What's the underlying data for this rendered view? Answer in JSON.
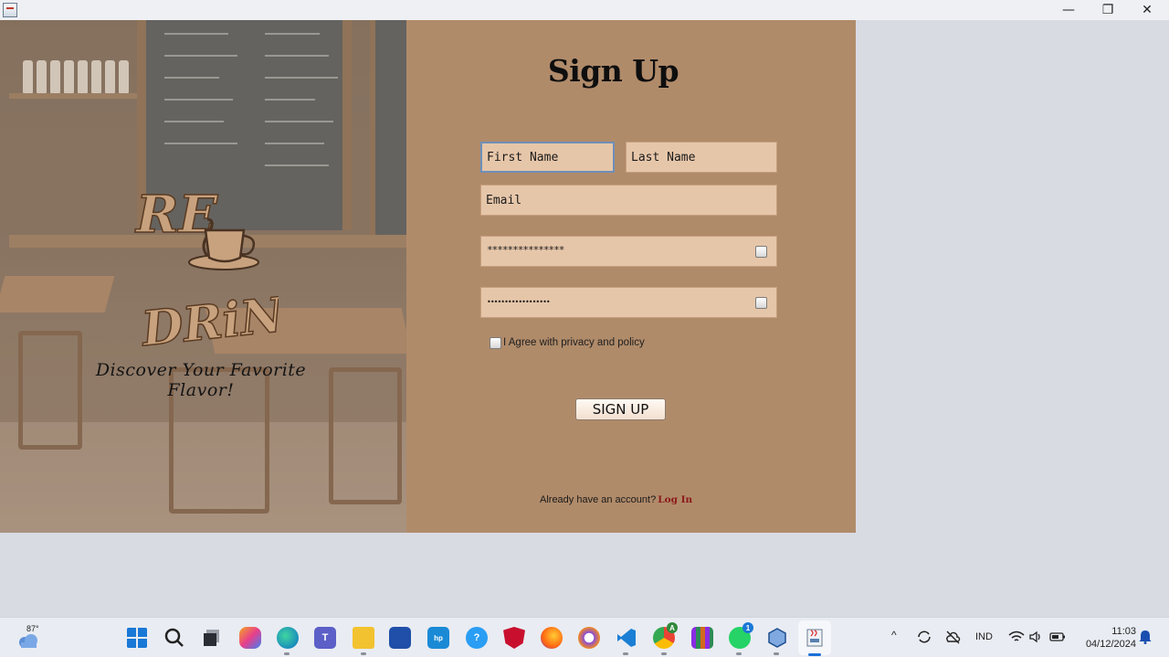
{
  "window": {
    "controls": {
      "minimize": "—",
      "maximize": "❐",
      "close": "✕"
    }
  },
  "hero": {
    "logo_text_top": "RE",
    "logo_text_bottom": "DRiNK",
    "tagline": "Discover Your Favorite Flavor!"
  },
  "form": {
    "title": "Sign Up",
    "first_name_placeholder": "First Name",
    "last_name_placeholder": "Last Name",
    "email_placeholder": "Email",
    "password_mask": "***************",
    "confirm_mask": "••••••••••••••••••",
    "agree_label": "I Agree with privacy and policy",
    "submit_label": "SIGN UP",
    "existing_prompt": "Already have an account?",
    "login_link": "Log In"
  },
  "taskbar": {
    "temperature": "87°",
    "language": "IND",
    "time": "11:03",
    "date": "04/12/2024",
    "teams_badge": "1",
    "whatsapp_badge": "1",
    "chrome_badge": "A"
  },
  "colors": {
    "panel": "#b08b6a",
    "field": "#e6c6a9",
    "link": "#8b1a1a",
    "desktop": "#d9dbe3"
  }
}
